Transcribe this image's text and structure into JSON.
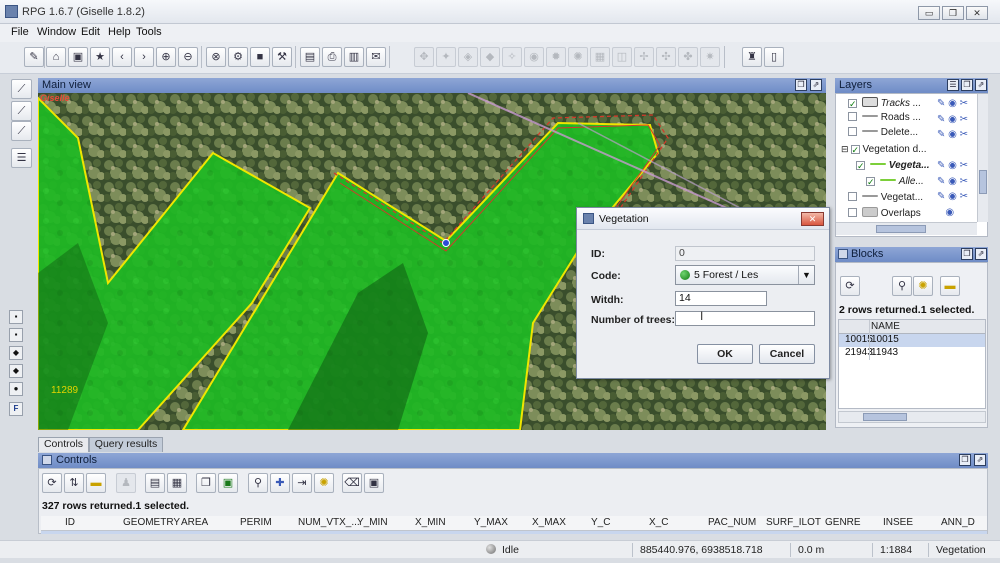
{
  "window": {
    "title": "RPG 1.6.7 (Giselle 1.8.2)",
    "minimize": "▭",
    "maximize": "❐",
    "close": "✕"
  },
  "menu": [
    "File",
    "Window",
    "Edit",
    "Help",
    "Tools"
  ],
  "main_view": {
    "title": "Main view",
    "user_label": "Giselle",
    "parcel_label": "11289"
  },
  "dialog": {
    "title": "Vegetation",
    "close_glyph": "✕",
    "fields": {
      "id_label": "ID:",
      "id_value": "0",
      "code_label": "Code:",
      "code_value": "5 Forest / Les",
      "width_label": "Witdh:",
      "width_value": "14",
      "trees_label": "Number of trees:",
      "trees_value": ""
    },
    "ok_label": "OK",
    "cancel_label": "Cancel"
  },
  "layers": {
    "title": "Layers",
    "items": [
      {
        "label": "Tracks ...",
        "checked": true
      },
      {
        "label": "Roads ...",
        "checked": false
      },
      {
        "label": "Delete...",
        "checked": false
      },
      {
        "label": "Vegetation d...",
        "checked": true
      },
      {
        "label": "Vegeta...",
        "checked": true
      },
      {
        "label": "Alle...",
        "checked": true
      },
      {
        "label": "Vegetat...",
        "checked": false
      },
      {
        "label": "Overlaps",
        "checked": false
      }
    ]
  },
  "blocks": {
    "title": "Blocks",
    "status": "2 rows returned.1 selected.",
    "column_header": "NAME",
    "rows": [
      {
        "id": "10015",
        "name": "10015"
      },
      {
        "id": "21943",
        "name": "11943"
      }
    ]
  },
  "tabs": [
    "Controls",
    "Query results"
  ],
  "controls": {
    "title": "Controls",
    "status": "327 rows returned.1 selected.",
    "columns": [
      "ID",
      "GEOMETRY",
      "AREA",
      "PERIM",
      "NUM_VTX_...",
      "Y_MIN",
      "X_MIN",
      "Y_MAX",
      "X_MAX",
      "Y_C",
      "X_C",
      "PAC_NUM",
      "SURF_ILOT",
      "GENRE",
      "INSEE",
      "ANN_D"
    ]
  },
  "statusbar": {
    "state": "Idle",
    "coordinates": "885440.976, 6938518.718",
    "distance": "0.0 m",
    "scale": "1:1884",
    "layer": "Vegetation"
  },
  "colors": {
    "panel_header": "#7f98cd",
    "parcel_fill": "#21c426",
    "parcel_border": "#f0e800",
    "selection_outline": "#d23a2a"
  }
}
